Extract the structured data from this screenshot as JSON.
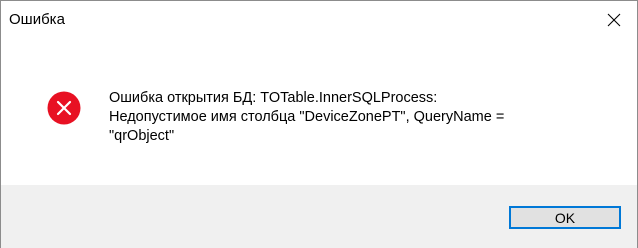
{
  "window": {
    "title": "Ошибка"
  },
  "icons": {
    "close": "close-icon",
    "error": "error-icon"
  },
  "dialog": {
    "message": "Ошибка открытия БД: TOTable.InnerSQLProcess:\nНедопустимое имя столбца \"DeviceZonePT\", QueryName =\n\"qrObject\"",
    "ok_label": "OK"
  },
  "colors": {
    "error_red": "#e81123",
    "button_focus_border": "#0078d7",
    "footer_bg": "#f0f0f0"
  }
}
